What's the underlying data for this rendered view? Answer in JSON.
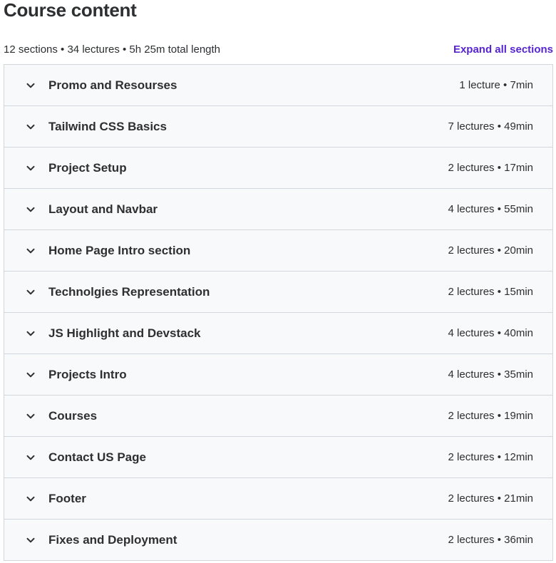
{
  "header": {
    "title": "Course content",
    "summary": "12 sections • 34 lectures • 5h 25m total length",
    "expand_all_label": "Expand all sections",
    "accent_color": "#5624d0"
  },
  "sections": [
    {
      "title": "Promo and Resourses",
      "meta": "1 lecture • 7min"
    },
    {
      "title": "Tailwind CSS Basics",
      "meta": "7 lectures • 49min"
    },
    {
      "title": "Project Setup",
      "meta": "2 lectures • 17min"
    },
    {
      "title": "Layout and Navbar",
      "meta": "4 lectures • 55min"
    },
    {
      "title": "Home Page Intro section",
      "meta": "2 lectures • 20min"
    },
    {
      "title": "Technolgies Representation",
      "meta": "2 lectures • 15min"
    },
    {
      "title": "JS Highlight and Devstack",
      "meta": "4 lectures • 40min"
    },
    {
      "title": "Projects Intro",
      "meta": "4 lectures • 35min"
    },
    {
      "title": "Courses",
      "meta": "2 lectures • 19min"
    },
    {
      "title": "Contact US Page",
      "meta": "2 lectures • 12min"
    },
    {
      "title": "Footer",
      "meta": "2 lectures • 21min"
    },
    {
      "title": "Fixes and Deployment",
      "meta": "2 lectures • 36min"
    }
  ]
}
